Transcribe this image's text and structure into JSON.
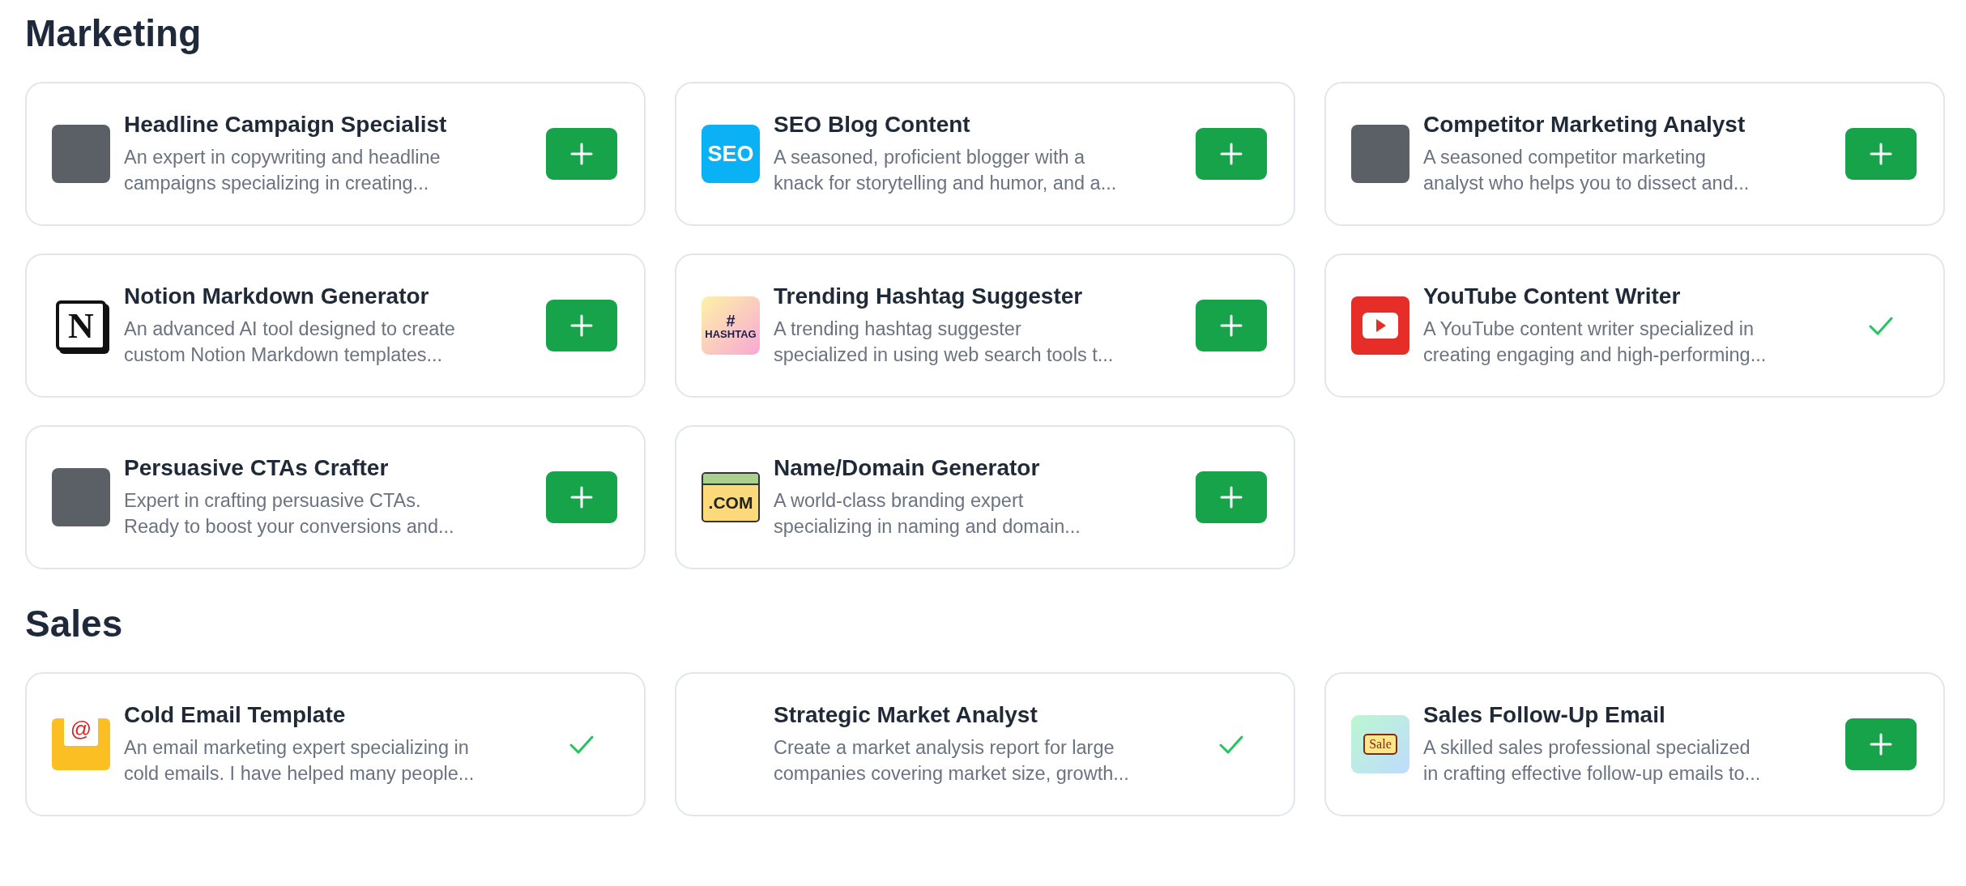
{
  "sections": [
    {
      "title": "Marketing",
      "agents": [
        {
          "kind": "photo",
          "name": "Headline Campaign Specialist",
          "description_lines": [
            "An expert in copywriting and headline",
            "campaigns specializing in creating..."
          ],
          "added": false
        },
        {
          "kind": "badge",
          "logo_text": "SEO",
          "name": "SEO Blog Content",
          "description_lines": [
            "A seasoned, proficient blogger with a",
            "knack for storytelling and humor, and a..."
          ],
          "added": false
        },
        {
          "kind": "photo",
          "name": "Competitor Marketing Analyst",
          "description_lines": [
            "A seasoned competitor marketing",
            "analyst who helps you to dissect and..."
          ],
          "added": false
        },
        {
          "kind": "cube",
          "logo_text": "N",
          "name": "Notion Markdown Generator",
          "description_lines": [
            "An advanced AI tool designed to create",
            "custom Notion Markdown templates..."
          ],
          "added": false
        },
        {
          "kind": "hashtag",
          "logo_text": "#",
          "logo_subtext": "HASHTAG",
          "name": "Trending Hashtag Suggester",
          "description_lines": [
            "A trending hashtag suggester",
            "specialized in using web search tools t..."
          ],
          "added": false
        },
        {
          "kind": "play",
          "name": "YouTube Content Writer",
          "description_lines": [
            "A YouTube content writer specialized in",
            "creating engaging and high-performing..."
          ],
          "added": true
        },
        {
          "kind": "photo",
          "name": "Persuasive CTAs Crafter",
          "description_lines": [
            "Expert in crafting persuasive CTAs.",
            "Ready to boost your conversions and..."
          ],
          "added": false
        },
        {
          "kind": "browser",
          "logo_text": ".COM",
          "name": "Name/Domain Generator",
          "description_lines": [
            "A world-class branding expert",
            "specializing in naming and domain..."
          ],
          "added": false
        }
      ]
    },
    {
      "title": "Sales",
      "agents": [
        {
          "kind": "envelope",
          "logo_text": "@",
          "name": "Cold Email Template",
          "description_lines": [
            "An email marketing expert specializing in",
            "cold emails. I have helped many people..."
          ],
          "added": true
        },
        {
          "kind": "none",
          "name": "Strategic Market Analyst",
          "description_lines": [
            "Create a market analysis report for large",
            "companies covering market size, growth..."
          ],
          "added": true
        },
        {
          "kind": "sale",
          "logo_text": "Sale",
          "name": "Sales Follow-Up Email",
          "description_lines": [
            "A skilled sales professional specialized",
            "in crafting effective follow-up emails to..."
          ],
          "added": false
        }
      ]
    }
  ]
}
